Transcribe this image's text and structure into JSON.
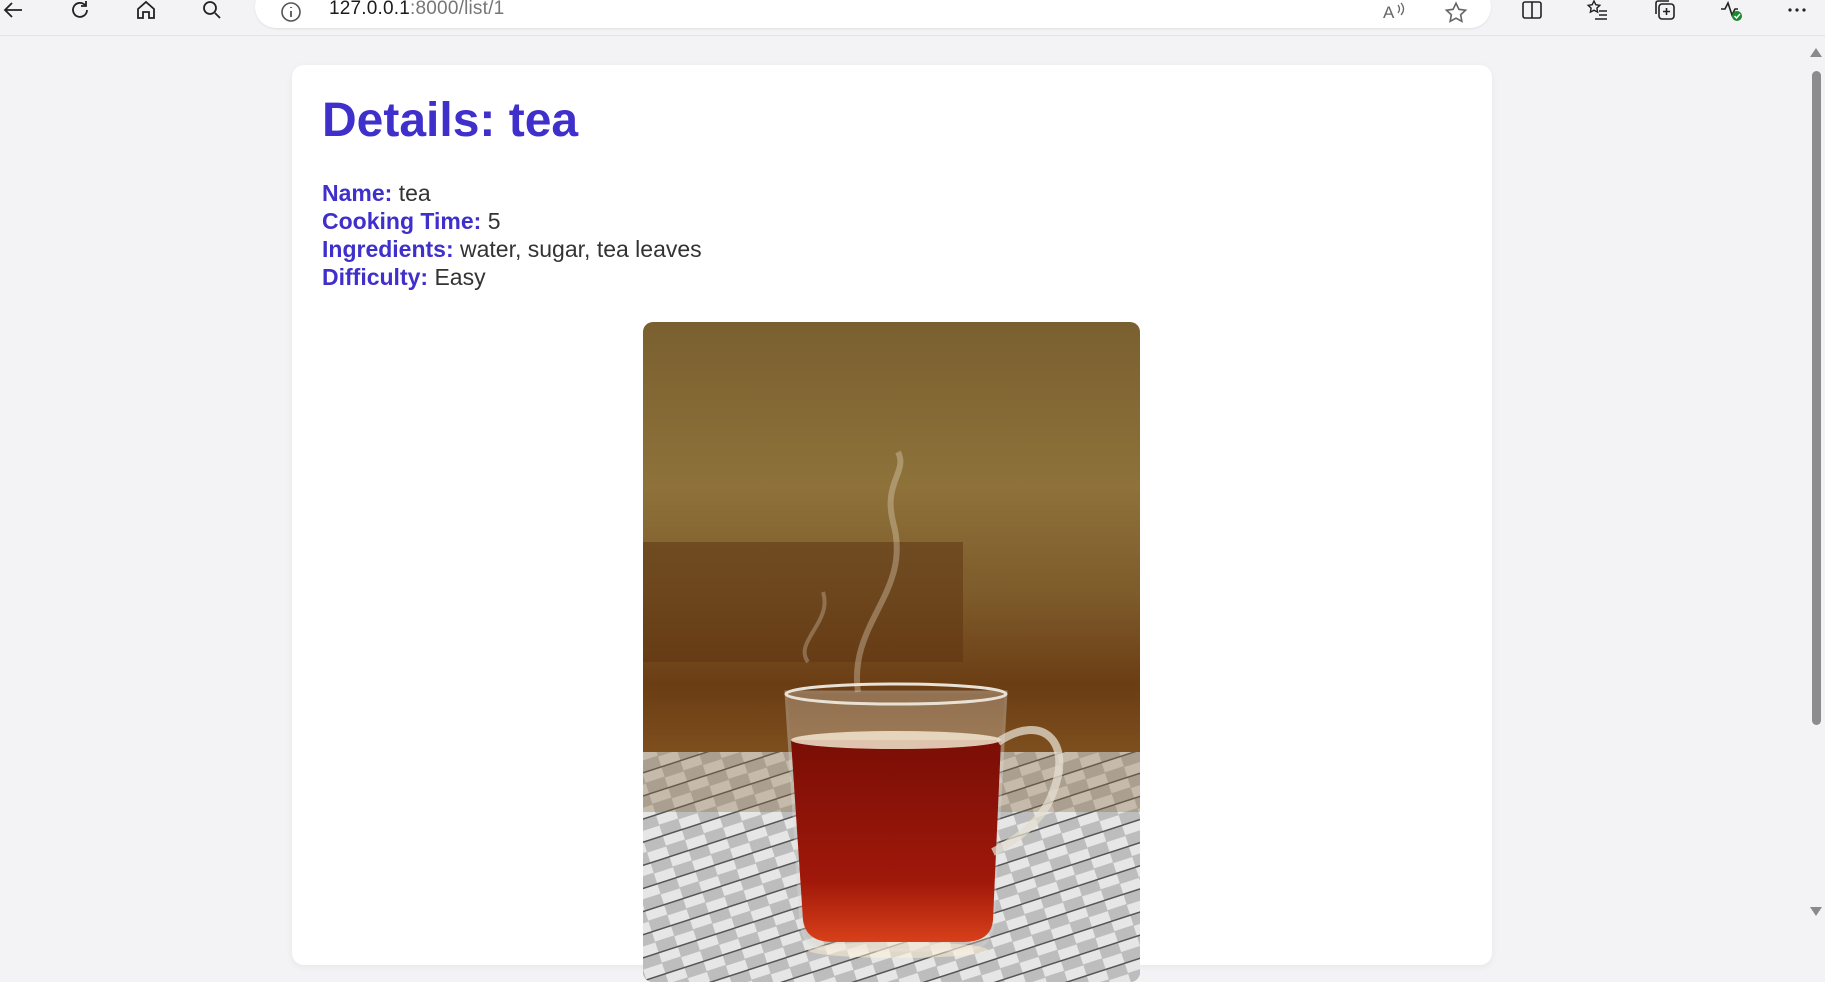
{
  "browser": {
    "url_host": "127.0.0.1",
    "url_rest": ":8000/list/1"
  },
  "page": {
    "title": "Details: tea",
    "fields": [
      {
        "label": "Name:",
        "value": "tea"
      },
      {
        "label": "Cooking Time:",
        "value": "5"
      },
      {
        "label": "Ingredients:",
        "value": "water, sugar, tea leaves"
      },
      {
        "label": "Difficulty:",
        "value": "Easy"
      }
    ]
  },
  "colors": {
    "accent": "#3f2fcb",
    "background": "#f3f3f6"
  },
  "icons": [
    "back-icon",
    "refresh-icon",
    "home-icon",
    "search-icon",
    "info-icon",
    "read-aloud-icon",
    "favorite-star-icon",
    "split-screen-icon",
    "favorites-list-icon",
    "collections-icon",
    "browser-essentials-icon",
    "more-options-icon"
  ]
}
